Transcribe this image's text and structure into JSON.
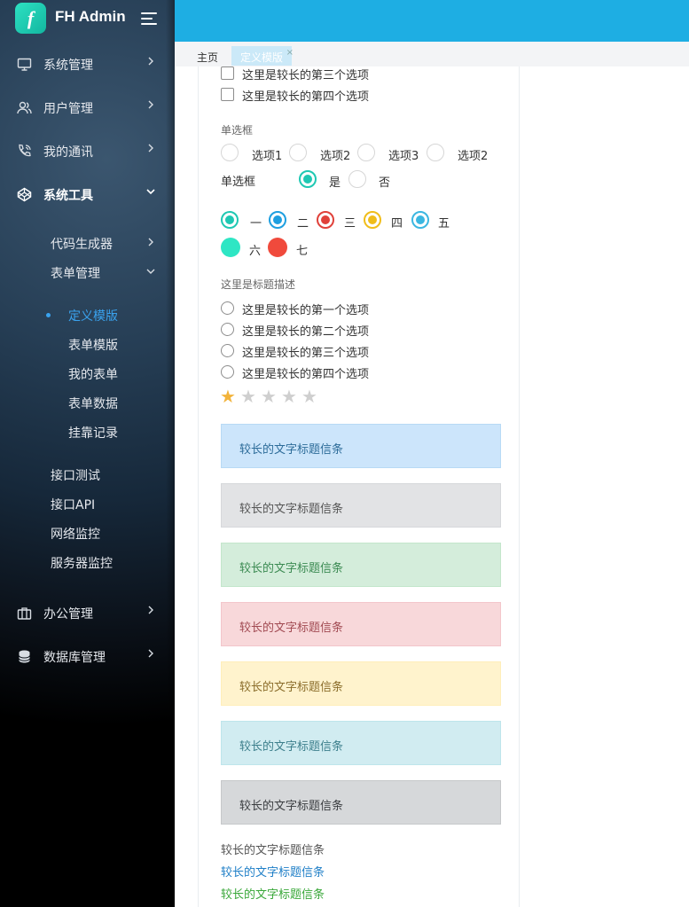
{
  "app": {
    "title": "FH Admin",
    "logo_letter": "f"
  },
  "sidebar": {
    "items": [
      {
        "label": "系统管理",
        "icon": "monitor-icon"
      },
      {
        "label": "用户管理",
        "icon": "users-icon"
      },
      {
        "label": "我的通讯",
        "icon": "phone-icon"
      },
      {
        "label": "系统工具",
        "icon": "codepen-icon"
      },
      {
        "label": "办公管理",
        "icon": "briefcase-icon"
      },
      {
        "label": "数据库管理",
        "icon": "database-icon"
      }
    ],
    "tools_sub": {
      "code_gen": "代码生成器",
      "form_mgmt": "表单管理",
      "form_leaves": [
        "定义模版",
        "表单模版",
        "我的表单",
        "表单数据",
        "挂靠记录"
      ],
      "others": [
        "接口测试",
        "接口API",
        "网络监控",
        "服务器监控"
      ]
    }
  },
  "tabs": {
    "home": "主页",
    "active": "定义模版",
    "close": "×"
  },
  "form": {
    "checkbox_options": [
      "这里是较长的第三个选项",
      "这里是较长的第四个选项"
    ],
    "radio_title": "单选框",
    "radio_options": [
      "选项1",
      "选项2",
      "选项3",
      "选项2"
    ],
    "yesno_label": "单选框",
    "yes": "是",
    "no": "否",
    "color_radios": [
      "一",
      "二",
      "三",
      "四",
      "五",
      "六",
      "七"
    ],
    "colors": {
      "teal": "#1fc8b3",
      "blue": "#1e9fe0",
      "red": "#e0413a",
      "yellow": "#f0bd1a",
      "cyan": "#3bb7e1",
      "teal_solid": "#2ee6c4",
      "red_solid": "#f04a3c"
    },
    "desc_title": "这里是标题描述",
    "list_options": [
      "这里是较长的第一个选项",
      "这里是较长的第二个选项",
      "这里是较长的第三个选项",
      "这里是较长的第四个选项"
    ],
    "rating": {
      "value": 1,
      "max": 5,
      "filled": "★",
      "empty": "★"
    }
  },
  "alerts": [
    {
      "text": "较长的文字标题信条",
      "bg": "#cce5fb",
      "border": "#b8daf5",
      "color": "#2d6c99"
    },
    {
      "text": "较长的文字标题信条",
      "bg": "#e2e3e5",
      "border": "#d6d8db",
      "color": "#555"
    },
    {
      "text": "较长的文字标题信条",
      "bg": "#d4eddb",
      "border": "#c3e6cb",
      "color": "#3b8a52"
    },
    {
      "text": "较长的文字标题信条",
      "bg": "#f8d8da",
      "border": "#f3c6cb",
      "color": "#a14a52"
    },
    {
      "text": "较长的文字标题信条",
      "bg": "#fff3cd",
      "border": "#ffeeba",
      "color": "#8a6d2b"
    },
    {
      "text": "较长的文字标题信条",
      "bg": "#d1ecf1",
      "border": "#bee5eb",
      "color": "#3d7f8c"
    },
    {
      "text": "较长的文字标题信条",
      "bg": "#d6d8da",
      "border": "#c6c8ca",
      "color": "#3a3d40"
    }
  ],
  "plain_lines": [
    {
      "text": "较长的文字标题信条",
      "color": "#555"
    },
    {
      "text": "较长的文字标题信条",
      "color": "#1f7fc7"
    },
    {
      "text": "较长的文字标题信条",
      "color": "#3aa83a"
    }
  ]
}
